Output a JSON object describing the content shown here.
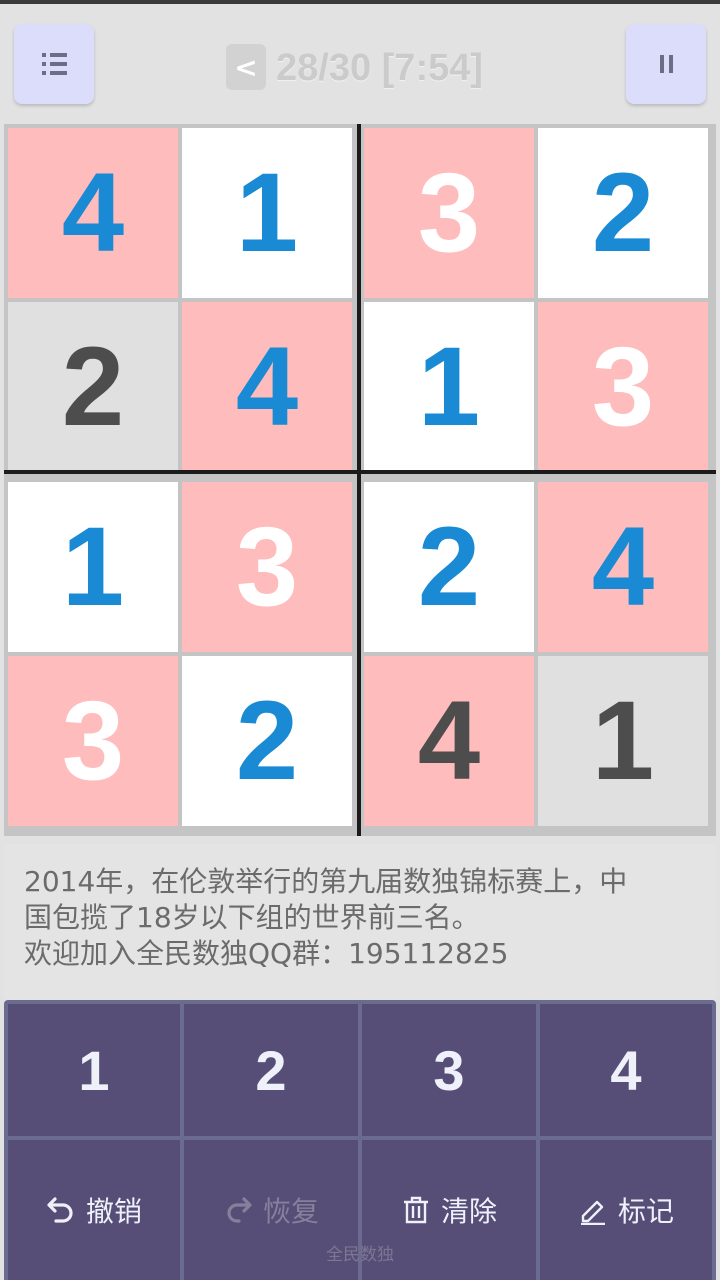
{
  "header": {
    "menu_icon": "menu-icon",
    "back_label": "<",
    "progress": "28/30 [7:54]",
    "pause_icon": "pause-icon"
  },
  "board": {
    "cells": [
      {
        "value": "4",
        "bg": "pink",
        "color": "blue"
      },
      {
        "value": "1",
        "bg": "white",
        "color": "blue"
      },
      {
        "value": "3",
        "bg": "pink",
        "color": "white"
      },
      {
        "value": "2",
        "bg": "white",
        "color": "blue"
      },
      {
        "value": "2",
        "bg": "gray",
        "color": "dark"
      },
      {
        "value": "4",
        "bg": "pink",
        "color": "blue"
      },
      {
        "value": "1",
        "bg": "white",
        "color": "blue"
      },
      {
        "value": "3",
        "bg": "pink",
        "color": "white"
      },
      {
        "value": "1",
        "bg": "white",
        "color": "blue"
      },
      {
        "value": "3",
        "bg": "pink",
        "color": "white"
      },
      {
        "value": "2",
        "bg": "white",
        "color": "blue"
      },
      {
        "value": "4",
        "bg": "pink",
        "color": "blue"
      },
      {
        "value": "3",
        "bg": "pink",
        "color": "white"
      },
      {
        "value": "2",
        "bg": "white",
        "color": "blue"
      },
      {
        "value": "4",
        "bg": "pink",
        "color": "dark"
      },
      {
        "value": "1",
        "bg": "gray",
        "color": "dark"
      }
    ]
  },
  "tip": {
    "line1": "2014年，在伦敦举行的第九届数独锦标赛上，中",
    "line2": "国包揽了18岁以下组的世界前三名。",
    "line3": "欢迎加入全民数独QQ群：195112825"
  },
  "keypad": {
    "numbers": [
      "1",
      "2",
      "3",
      "4"
    ],
    "undo_label": "撤销",
    "redo_label": "恢复",
    "clear_label": "清除",
    "mark_label": "标记"
  },
  "footer": {
    "brand": "全民数独"
  },
  "colors": {
    "pink": "#febcbc",
    "blue": "#1a8ad4",
    "keypad": "#564e76",
    "accent_button": "#dcdcfb"
  }
}
